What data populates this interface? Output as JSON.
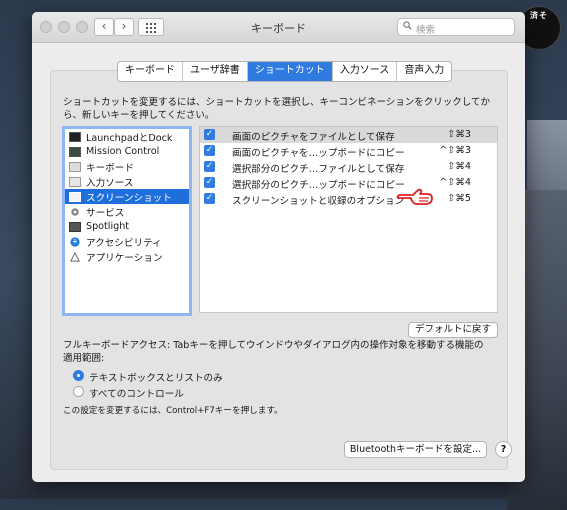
{
  "watermark": {
    "line1": "",
    "line2": "済そ"
  },
  "window": {
    "title": "キーボード",
    "nav_back": "‹",
    "nav_forward": "›",
    "search_placeholder": "検索"
  },
  "tabs": [
    {
      "label": "キーボード",
      "active": false
    },
    {
      "label": "ユーザ辞書",
      "active": false
    },
    {
      "label": "ショートカット",
      "active": true
    },
    {
      "label": "入力ソース",
      "active": false
    },
    {
      "label": "音声入力",
      "active": false
    }
  ],
  "instruction": "ショートカットを変更するには、ショートカットを選択し、キーコンビネーションをクリックしてから、新しいキーを押してください。",
  "categories": [
    {
      "label": "LaunchpadとDock",
      "icon": "launchpad-dock-icon",
      "selected": false
    },
    {
      "label": "Mission Control",
      "icon": "mission-control-icon",
      "selected": false
    },
    {
      "label": "キーボード",
      "icon": "keyboard-icon",
      "selected": false
    },
    {
      "label": "入力ソース",
      "icon": "input-source-icon",
      "selected": false
    },
    {
      "label": "スクリーンショット",
      "icon": "screenshot-icon",
      "selected": true
    },
    {
      "label": "サービス",
      "icon": "gear-icon",
      "selected": false
    },
    {
      "label": "Spotlight",
      "icon": "spotlight-icon",
      "selected": false
    },
    {
      "label": "アクセシビリティ",
      "icon": "accessibility-icon",
      "selected": false
    },
    {
      "label": "アプリケーション",
      "icon": "app-shortcuts-icon",
      "selected": false
    }
  ],
  "shortcuts": [
    {
      "label": "画面のピクチャをファイルとして保存",
      "keys": "⇧⌘3",
      "checked": true,
      "selected": true
    },
    {
      "label": "画面のピクチャを…ップボードにコピー",
      "keys": "^⇧⌘3",
      "checked": true,
      "selected": false
    },
    {
      "label": "選択部分のピクチ…ファイルとして保存",
      "keys": "⇧⌘4",
      "checked": true,
      "selected": false
    },
    {
      "label": "選択部分のピクチ…ップボードにコピー",
      "keys": "^⇧⌘4",
      "checked": true,
      "selected": false
    },
    {
      "label": "スクリーンショットと収録のオプション",
      "keys": "⇧⌘5",
      "checked": true,
      "selected": false
    }
  ],
  "restore_defaults_label": "デフォルトに戻す",
  "full_keyboard_access": "フルキーボードアクセス: Tabキーを押してウインドウやダイアログ内の操作対象を移動する機能の適用範囲:",
  "radio_options": [
    {
      "label": "テキストボックスとリストのみ",
      "selected": true
    },
    {
      "label": "すべてのコントロール",
      "selected": false
    }
  ],
  "hint": "この設定を変更するには、Control+F7キーを押します。",
  "bluetooth_button_label": "Bluetoothキーボードを設定...",
  "help_label": "?",
  "colors": {
    "accent": "#2f7be0",
    "selection": "#1e6fdc",
    "hand": "#e02020"
  }
}
